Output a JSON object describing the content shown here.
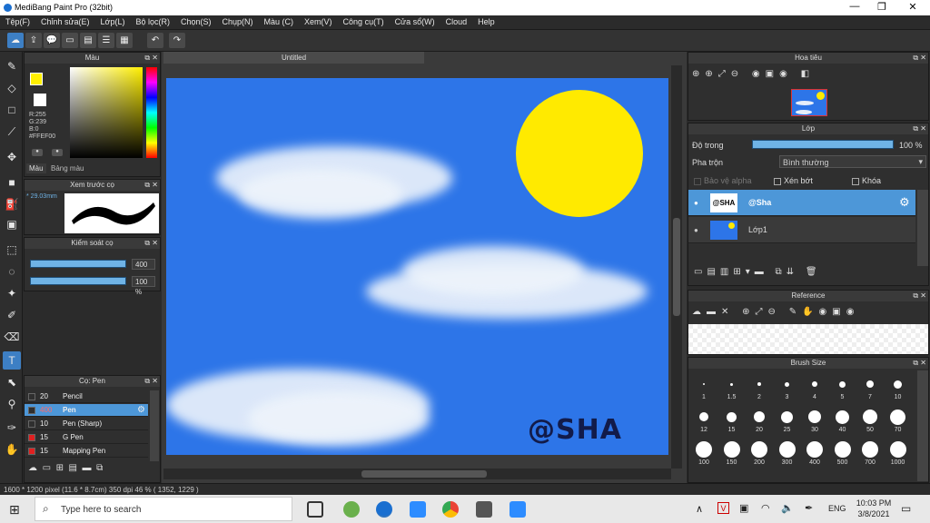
{
  "window": {
    "title": "MediBang Paint Pro (32bit)",
    "min": "—",
    "max": "❐",
    "close": "✕"
  },
  "menu": [
    "Tệp(F)",
    "Chỉnh sửa(E)",
    "Lớp(L)",
    "Bộ lọc(R)",
    "Chọn(S)",
    "Chụp(N)",
    "Màu (C)",
    "Xem(V)",
    "Công cụ(T)",
    "Cửa sổ(W)",
    "Cloud",
    "Help"
  ],
  "color_panel": {
    "title": "Màu",
    "r": "R:255",
    "g": "G:239",
    "b": "B:0",
    "hex": "#FFEF00",
    "tab1": "Màu",
    "tab2": "Bảng màu",
    "primary": "#ffef00"
  },
  "brush_preview": {
    "title": "Xem trước cọ",
    "size": "29.03mm"
  },
  "brush_control": {
    "title": "Kiểm soát cọ",
    "size_value": "400",
    "opacity_value": "100 %"
  },
  "brush_list": {
    "title": "Cọ: Pen",
    "items": [
      {
        "size": "20",
        "name": "Pencil",
        "color": "#2f2f2f",
        "selected": false
      },
      {
        "size": "400",
        "name": "Pen",
        "color": "#2f2f2f",
        "selected": true
      },
      {
        "size": "10",
        "name": "Pen (Sharp)",
        "color": "#2f2f2f",
        "selected": false
      },
      {
        "size": "15",
        "name": "G Pen",
        "color": "#e02020",
        "selected": false
      },
      {
        "size": "15",
        "name": "Mapping Pen",
        "color": "#e02020",
        "selected": false
      }
    ]
  },
  "document": {
    "tab": "Untitled",
    "signature": "@SHA"
  },
  "navigator": {
    "title": "Hoa tiêu"
  },
  "layer_panel": {
    "title": "Lớp",
    "opacity_label": "Độ trong",
    "opacity_value": "100 %",
    "blend_label": "Pha trộn",
    "blend_value": "Bình thường",
    "protect_alpha": "Bảo vệ alpha",
    "clipping": "Xén bớt",
    "lock": "Khóa",
    "layers": [
      {
        "name": "@Sha",
        "thumb": "@SHA",
        "selected": true
      },
      {
        "name": "Lớp1",
        "thumb": "",
        "selected": false
      }
    ]
  },
  "reference": {
    "title": "Reference"
  },
  "brush_size": {
    "title": "Brush Size",
    "sizes": [
      "1",
      "1.5",
      "2",
      "3",
      "4",
      "5",
      "7",
      "10",
      "12",
      "15",
      "20",
      "25",
      "30",
      "40",
      "50",
      "70",
      "100",
      "150",
      "200",
      "300",
      "400",
      "500",
      "700",
      "1000"
    ]
  },
  "status": "1600 * 1200 pixel   (11.6 * 8.7cm)   350 dpi   46 %   ( 1352, 1229 )",
  "taskbar": {
    "search_placeholder": "Type here to search",
    "lang": "ENG",
    "time": "10:03 PM",
    "date": "3/8/2021"
  }
}
